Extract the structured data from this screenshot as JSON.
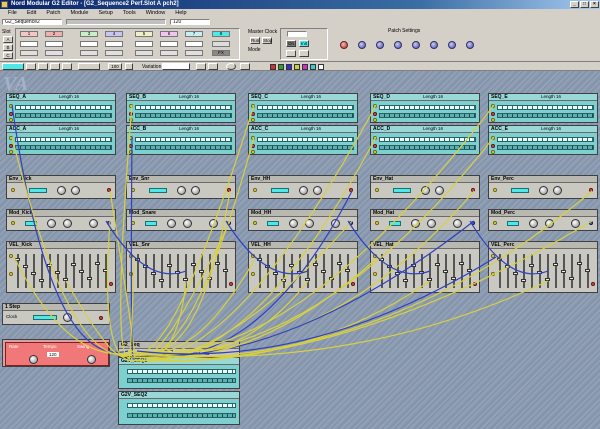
{
  "window": {
    "title": "Nord Modular G2 Editor - [G2_Sequence2 Perf.Slot A pch2]"
  },
  "menu": [
    "File",
    "Edit",
    "Patch",
    "Module",
    "Setup",
    "Tools",
    "Window",
    "Help"
  ],
  "panel": {
    "patch_name": "G2_Sequence2",
    "slot_labels": [
      "Slot",
      "A",
      "B",
      "C",
      "D"
    ],
    "variation_label": "Var",
    "vars": [
      "1",
      "2",
      "3",
      "4",
      "5",
      "6",
      "7",
      "8"
    ],
    "mode_label": "Mode",
    "mode_value": "FX",
    "master_clock": "Master Clock",
    "bpm_value": "120",
    "buttons": {
      "run": "Run",
      "stop": "Stop",
      "on": "On",
      "init": "Init"
    },
    "patch_settings": "Patch Settings",
    "morph_labels": [
      "Morph",
      "Gate",
      "Sel",
      "Tone",
      "Pitch",
      "Rev",
      "Filter",
      "Mod"
    ]
  },
  "toolbar": {
    "zoom": "100",
    "var_label": "Variation",
    "color_swatches": [
      "#d03030",
      "#30a030",
      "#3030d0",
      "#d0d030",
      "#d030d0",
      "#30d0d0",
      "#ffffff"
    ]
  },
  "canvas": {
    "brand_mark": "VA",
    "seq_rows": [
      [
        "SEQ_A",
        "SEQ_B",
        "SEQ_C",
        "SEQ_D",
        "SEQ_E"
      ],
      [
        "ACC_A",
        "ACC_B",
        "ACC_C",
        "ACC_D",
        "ACC_E"
      ]
    ],
    "step_label": "Length",
    "step_value": "16",
    "env_row": [
      "Env_Kick",
      "Env_Snr",
      "Env_HH",
      "Env_Hat",
      "Env_Perc"
    ],
    "osc_row": [
      "Mod_Kick",
      "Mod_Snare",
      "Mod_HH",
      "Mod_Hat",
      "Mod_Perc"
    ],
    "mix_row": [
      "VEL_Kick",
      "VEL_Snr",
      "VEL_HH",
      "VEL_Hat",
      "VEL_Perc"
    ],
    "clock_module": {
      "title": "1 Step",
      "sub": "Clock"
    },
    "ctrl_module": {
      "labels": [
        "Rate",
        "Tempo",
        "Swing"
      ],
      "value": "120"
    },
    "bottom_modules": [
      "G2_Seq",
      "G2V_SEQ1",
      "G2V_SEQ2"
    ]
  }
}
